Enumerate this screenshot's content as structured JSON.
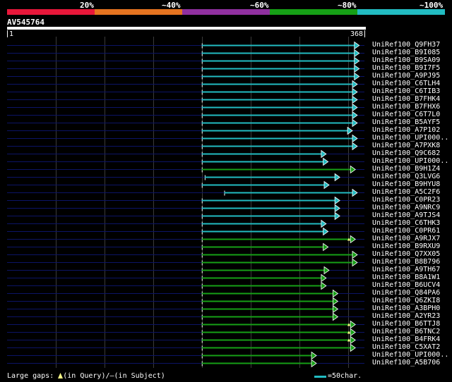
{
  "header": {
    "scale_labels": [
      "20%",
      "~40%",
      "~60%",
      "~80%",
      "~100%"
    ],
    "band_colors": [
      "#e8173a",
      "#e67420",
      "#9030a0",
      "#16a016",
      "#22bcc2"
    ]
  },
  "query": {
    "name": "AV545764",
    "start_label": "1",
    "end_label": "368",
    "length": 368
  },
  "footer": {
    "gaps_label": "Large gaps:",
    "gap_query_icon": "triangle-up-icon",
    "query_text": "(in Query)/",
    "subject_glyph": "—",
    "subject_text": "(in Subject)",
    "scale_text": "=50char."
  },
  "colors": {
    "cyan": "#22bcc2",
    "green": "#16a016",
    "navy": "#0c1466",
    "grid": "#3a3a3a",
    "gap_marker": "#ffff88"
  },
  "hits": [
    {
      "id": "UniRef100_Q9FH37",
      "color": "cyan",
      "start": 201,
      "end": 362,
      "gaps": []
    },
    {
      "id": "UniRef100_B9I085",
      "color": "cyan",
      "start": 201,
      "end": 362,
      "gaps": []
    },
    {
      "id": "UniRef100_B9SA09",
      "color": "cyan",
      "start": 201,
      "end": 362,
      "gaps": []
    },
    {
      "id": "UniRef100_B9I7F5",
      "color": "cyan",
      "start": 201,
      "end": 362,
      "gaps": []
    },
    {
      "id": "UniRef100_A9PJ95",
      "color": "cyan",
      "start": 201,
      "end": 362,
      "gaps": []
    },
    {
      "id": "UniRef100_C6TLH4",
      "color": "cyan",
      "start": 201,
      "end": 360,
      "gaps": []
    },
    {
      "id": "UniRef100_C6TIB3",
      "color": "cyan",
      "start": 201,
      "end": 360,
      "gaps": []
    },
    {
      "id": "UniRef100_B7FHK4",
      "color": "cyan",
      "start": 201,
      "end": 360,
      "gaps": []
    },
    {
      "id": "UniRef100_B7FHX6",
      "color": "cyan",
      "start": 201,
      "end": 360,
      "gaps": []
    },
    {
      "id": "UniRef100_C6T7L0",
      "color": "cyan",
      "start": 201,
      "end": 360,
      "gaps": []
    },
    {
      "id": "UniRef100_B5AYF5",
      "color": "cyan",
      "start": 201,
      "end": 360,
      "gaps": []
    },
    {
      "id": "UniRef100_A7P102",
      "color": "cyan",
      "start": 201,
      "end": 355,
      "gaps": []
    },
    {
      "id": "UniRef100_UPI000..",
      "color": "cyan",
      "start": 201,
      "end": 360,
      "gaps": []
    },
    {
      "id": "UniRef100_A7PXK8",
      "color": "cyan",
      "start": 201,
      "end": 360,
      "gaps": []
    },
    {
      "id": "UniRef100_Q9C682",
      "color": "cyan",
      "start": 201,
      "end": 328,
      "gaps": []
    },
    {
      "id": "UniRef100_UPI000..",
      "color": "cyan",
      "start": 201,
      "end": 330,
      "gaps": []
    },
    {
      "id": "UniRef100_B9H1Z4",
      "color": "green",
      "start": 201,
      "end": 358,
      "gaps": []
    },
    {
      "id": "UniRef100_Q3LVG6",
      "color": "cyan",
      "start": 204,
      "end": 342,
      "gaps": []
    },
    {
      "id": "UniRef100_B9HYU8",
      "color": "cyan",
      "start": 201,
      "end": 331,
      "gaps": []
    },
    {
      "id": "UniRef100_A5C2F6",
      "color": "cyan",
      "start": 224,
      "end": 360,
      "gaps": []
    },
    {
      "id": "UniRef100_C0PR23",
      "color": "cyan",
      "start": 201,
      "end": 342,
      "gaps": []
    },
    {
      "id": "UniRef100_A9NRC9",
      "color": "cyan",
      "start": 201,
      "end": 342,
      "gaps": []
    },
    {
      "id": "UniRef100_A9TJS4",
      "color": "cyan",
      "start": 201,
      "end": 342,
      "gaps": []
    },
    {
      "id": "UniRef100_C6THK3",
      "color": "cyan",
      "start": 201,
      "end": 328,
      "gaps": []
    },
    {
      "id": "UniRef100_C0PR61",
      "color": "cyan",
      "start": 201,
      "end": 330,
      "gaps": []
    },
    {
      "id": "UniRef100_A9RJX7",
      "color": "green",
      "start": 201,
      "end": 358,
      "gaps": [
        352
      ]
    },
    {
      "id": "UniRef100_B9RXU9",
      "color": "green",
      "start": 201,
      "end": 330,
      "gaps": []
    },
    {
      "id": "UniRef100_Q7XX05",
      "color": "green",
      "start": 201,
      "end": 360,
      "gaps": []
    },
    {
      "id": "UniRef100_B8B796",
      "color": "green",
      "start": 201,
      "end": 360,
      "gaps": []
    },
    {
      "id": "UniRef100_A9TH67",
      "color": "green",
      "start": 201,
      "end": 331,
      "gaps": []
    },
    {
      "id": "UniRef100_B8A1W1",
      "color": "green",
      "start": 201,
      "end": 328,
      "gaps": []
    },
    {
      "id": "UniRef100_B6UCV4",
      "color": "green",
      "start": 201,
      "end": 328,
      "gaps": []
    },
    {
      "id": "UniRef100_Q84PA6",
      "color": "green",
      "start": 201,
      "end": 340,
      "gaps": []
    },
    {
      "id": "UniRef100_Q6ZKI8",
      "color": "green",
      "start": 201,
      "end": 340,
      "gaps": []
    },
    {
      "id": "UniRef100_A3BPH0",
      "color": "green",
      "start": 201,
      "end": 340,
      "gaps": []
    },
    {
      "id": "UniRef100_A2YR23",
      "color": "green",
      "start": 201,
      "end": 340,
      "gaps": []
    },
    {
      "id": "UniRef100_B6TTJ8",
      "color": "green",
      "start": 201,
      "end": 358,
      "gaps": [
        352
      ]
    },
    {
      "id": "UniRef100_B6TNC2",
      "color": "green",
      "start": 201,
      "end": 358,
      "gaps": [
        352
      ]
    },
    {
      "id": "UniRef100_B4FRK4",
      "color": "green",
      "start": 201,
      "end": 358,
      "gaps": [
        352
      ]
    },
    {
      "id": "UniRef100_C5XAT2",
      "color": "green",
      "start": 201,
      "end": 358,
      "gaps": []
    },
    {
      "id": "UniRef100_UPI000..",
      "color": "green",
      "start": 201,
      "end": 318,
      "gaps": []
    },
    {
      "id": "UniRef100_A5B706",
      "color": "green",
      "start": 201,
      "end": 318,
      "gaps": []
    }
  ]
}
